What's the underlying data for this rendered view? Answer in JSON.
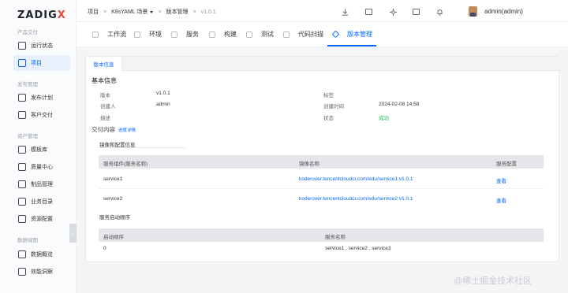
{
  "app": {
    "logo_text": "ZADIG",
    "logo_accent": "X"
  },
  "sidebar": {
    "groups": [
      {
        "label": "产品交付"
      },
      {
        "label": "发布管理"
      },
      {
        "label": "资产管理"
      },
      {
        "label": "数据视图"
      }
    ],
    "items": [
      {
        "label": "运行状态"
      },
      {
        "label": "项目"
      },
      {
        "label": "发布计划"
      },
      {
        "label": "客户交付"
      },
      {
        "label": "模板库"
      },
      {
        "label": "质量中心"
      },
      {
        "label": "制品管理"
      },
      {
        "label": "业务目录"
      },
      {
        "label": "资源配置"
      },
      {
        "label": "数据概览"
      },
      {
        "label": "效能洞察"
      }
    ]
  },
  "breadcrumb": {
    "root": "项目",
    "project": "K8sYAML 场景",
    "section": "版本管理",
    "current": "v1.0.1"
  },
  "user": {
    "name": "admin(admin)"
  },
  "tabs": [
    {
      "label": "工作流"
    },
    {
      "label": "环境"
    },
    {
      "label": "服务"
    },
    {
      "label": "构建"
    },
    {
      "label": "测试"
    },
    {
      "label": "代码扫描"
    },
    {
      "label": "版本管理"
    }
  ],
  "detail": {
    "tab_label": "版本信息",
    "basic_title": "基本信息",
    "fields": {
      "version_key": "版本",
      "version_val": "v1.0.1",
      "tag_key": "标签",
      "tag_val": "",
      "creator_key": "创建人",
      "creator_val": "admin",
      "created_key": "创建时间",
      "created_val": "2024-02-08 14:58",
      "desc_key": "描述",
      "desc_val": "",
      "status_key": "状态",
      "status_val": "成功"
    },
    "delivery_title": "交付内容",
    "progress_link": "进度详情",
    "image_section": "镜像和配置信息",
    "image_table": {
      "headers": [
        "服务组件(服务名称)",
        "镜像名称",
        "服务配置"
      ],
      "rows": [
        {
          "service": "service1",
          "image": "koderover.tencentcloudcr.com/edu/service1:v1.0.1",
          "action": "查看"
        },
        {
          "service": "service2",
          "image": "koderover.tencentcloudcr.com/edu/service2:v1.0.1",
          "action": "查看"
        }
      ]
    },
    "order_section": "服务启动顺序",
    "order_table": {
      "headers": [
        "启动顺序",
        "服务名称"
      ],
      "rows": [
        {
          "order": "0",
          "services": "service1 , service2 , service3"
        }
      ]
    }
  },
  "watermark": "@稀土掘金技术社区"
}
